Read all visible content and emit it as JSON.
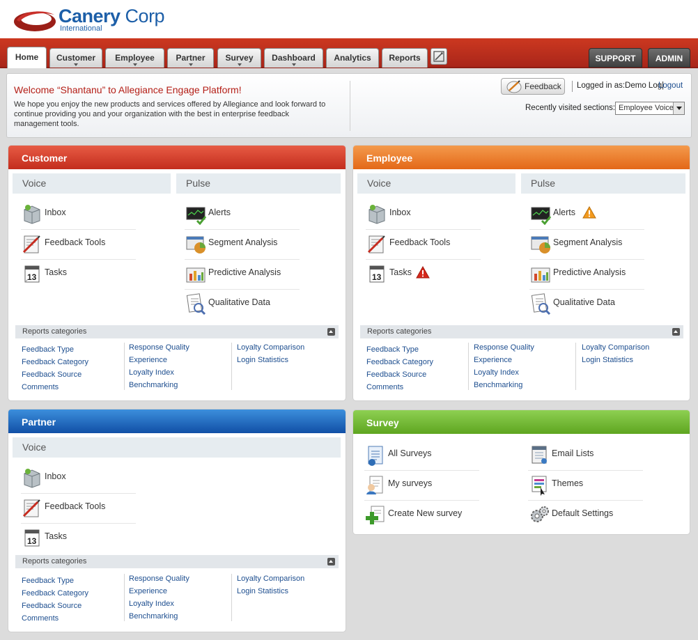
{
  "brand": {
    "name_bold": "Canery",
    "name_light": " Corp",
    "subtitle": "International"
  },
  "nav": {
    "tabs": [
      {
        "label": "Home"
      },
      {
        "label": "Customer"
      },
      {
        "label": "Employee"
      },
      {
        "label": "Partner"
      },
      {
        "label": "Survey"
      },
      {
        "label": "Dashboard"
      },
      {
        "label": "Analytics"
      },
      {
        "label": "Reports"
      }
    ],
    "support": "SUPPORT",
    "admin": "ADMIN"
  },
  "welcome": {
    "title": "Welcome “Shantanu” to Allegiance Engage Platform!",
    "description": "We hope you enjoy the new products and services offered by Allegiance and look forward to continue providing you and your organization with the best in enterprise feedback management tools.",
    "feedback_button": "Feedback",
    "logged_in": "Logged in as:Demo Log|",
    "logout": "Logout",
    "recent_label": "Recently visited sections:",
    "recent_value": "Employee Voice"
  },
  "colors": {
    "customer": "#d9402a",
    "employee": "#ec7c2c",
    "partner": "#1e6cc4",
    "survey": "#73bb33",
    "link": "#1d4e8f"
  },
  "customer": {
    "title": "Customer",
    "voice": "Voice",
    "pulse": "Pulse",
    "inbox": "Inbox",
    "feedback_tools": "Feedback Tools",
    "tasks": "Tasks",
    "alerts": "Alerts",
    "segment": "Segment Analysis",
    "predictive": "Predictive Analysis",
    "qualitative": "Qualitative Data",
    "reports": "Reports categories",
    "links": [
      "Feedback Type",
      "Feedback Category",
      "Feedback Source",
      "Comments",
      "Response Quality",
      "Experience",
      "Loyalty Index",
      "Benchmarking",
      "Loyalty Comparison",
      "Login Statistics"
    ]
  },
  "employee": {
    "title": "Employee",
    "voice": "Voice",
    "pulse": "Pulse",
    "inbox": "Inbox",
    "feedback_tools": "Feedback Tools",
    "tasks": "Tasks",
    "alerts": "Alerts",
    "segment": "Segment Analysis",
    "predictive": "Predictive Analysis",
    "qualitative": "Qualitative Data",
    "reports": "Reports categories",
    "links": [
      "Feedback Type",
      "Feedback Category",
      "Feedback Source",
      "Comments",
      "Response Quality",
      "Experience",
      "Loyalty Index",
      "Benchmarking",
      "Loyalty Comparison",
      "Login Statistics"
    ]
  },
  "partner": {
    "title": "Partner",
    "voice": "Voice",
    "inbox": "Inbox",
    "feedback_tools": "Feedback Tools",
    "tasks": "Tasks",
    "reports": "Reports categories",
    "links": [
      "Feedback Type",
      "Feedback Category",
      "Feedback Source",
      "Comments",
      "Response Quality",
      "Experience",
      "Loyalty Index",
      "Benchmarking",
      "Loyalty Comparison",
      "Login Statistics"
    ]
  },
  "survey": {
    "title": "Survey",
    "all": "All Surveys",
    "mine": "My surveys",
    "create": "Create New survey",
    "email": "Email Lists",
    "themes": "Themes",
    "defaults": "Default Settings"
  }
}
